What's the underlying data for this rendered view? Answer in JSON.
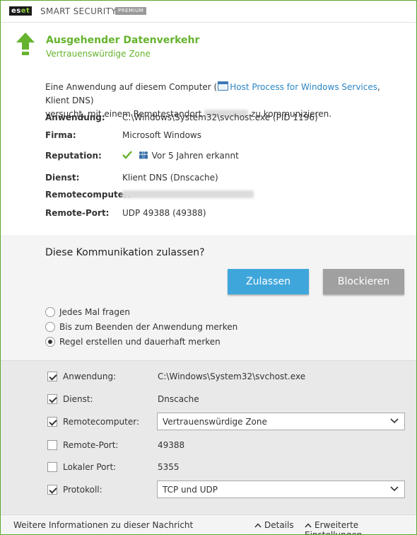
{
  "titlebar": {
    "logo_part1": "es",
    "logo_part2": "et",
    "product": "SMART SECURITY",
    "edition": "PREMIUM"
  },
  "header": {
    "title": "Ausgehender Datenverkehr",
    "subtitle": "Vertrauenswürdige Zone"
  },
  "description": {
    "part1": "Eine Anwendung auf diesem Computer (",
    "process_link": "Host Process for Windows Services",
    "part2": ", Klient DNS)",
    "part3": "versucht, mit einem Remotestandort",
    "part4": "zu kommunizieren."
  },
  "details": {
    "application_label": "Anwendung:",
    "application_value": "C:\\Windows\\System32\\svchost.exe (PID 1196)",
    "company_label": "Firma:",
    "company_value": "Microsoft Windows",
    "reputation_label": "Reputation:",
    "reputation_value": "Vor 5 Jahren erkannt",
    "service_label": "Dienst:",
    "service_value": "Klient DNS (Dnscache)",
    "remote_computer_label": "Remotecomputer:",
    "remote_port_label": "Remote-Port:",
    "remote_port_value": "UDP 49388 (49388)"
  },
  "question": {
    "text": "Diese Kommunikation zulassen?",
    "allow_label": "Zulassen",
    "block_label": "Blockieren"
  },
  "options": [
    {
      "label": "Jedes Mal fragen",
      "selected": false
    },
    {
      "label": "Bis zum Beenden der Anwendung merken",
      "selected": false
    },
    {
      "label": "Regel erstellen und dauerhaft merken",
      "selected": true
    }
  ],
  "rule": {
    "application": {
      "label": "Anwendung:",
      "value": "C:\\Windows\\System32\\svchost.exe",
      "checked": true
    },
    "service": {
      "label": "Dienst:",
      "value": "Dnscache",
      "checked": true
    },
    "remote_computer": {
      "label": "Remotecomputer:",
      "value": "Vertrauenswürdige Zone",
      "checked": true
    },
    "remote_port": {
      "label": "Remote-Port:",
      "value": "49388",
      "checked": false
    },
    "local_port": {
      "label": "Lokaler Port:",
      "value": "5355",
      "checked": false
    },
    "protocol": {
      "label": "Protokoll:",
      "value": "TCP und UDP",
      "checked": true
    }
  },
  "footer": {
    "info": "Weitere Informationen zu dieser Nachricht",
    "details": "Details",
    "advanced": "Erweiterte Einstellungen"
  },
  "colors": {
    "accent_green": "#65b32e",
    "allow_blue": "#3fa6dc",
    "block_gray": "#a0a0a0",
    "link_blue": "#2a85c4"
  },
  "icons": [
    "eset-logo",
    "upload-arrow-icon",
    "process-window-icon",
    "check-icon",
    "people-icon",
    "chevron-down-icon",
    "chevron-up-icon"
  ]
}
